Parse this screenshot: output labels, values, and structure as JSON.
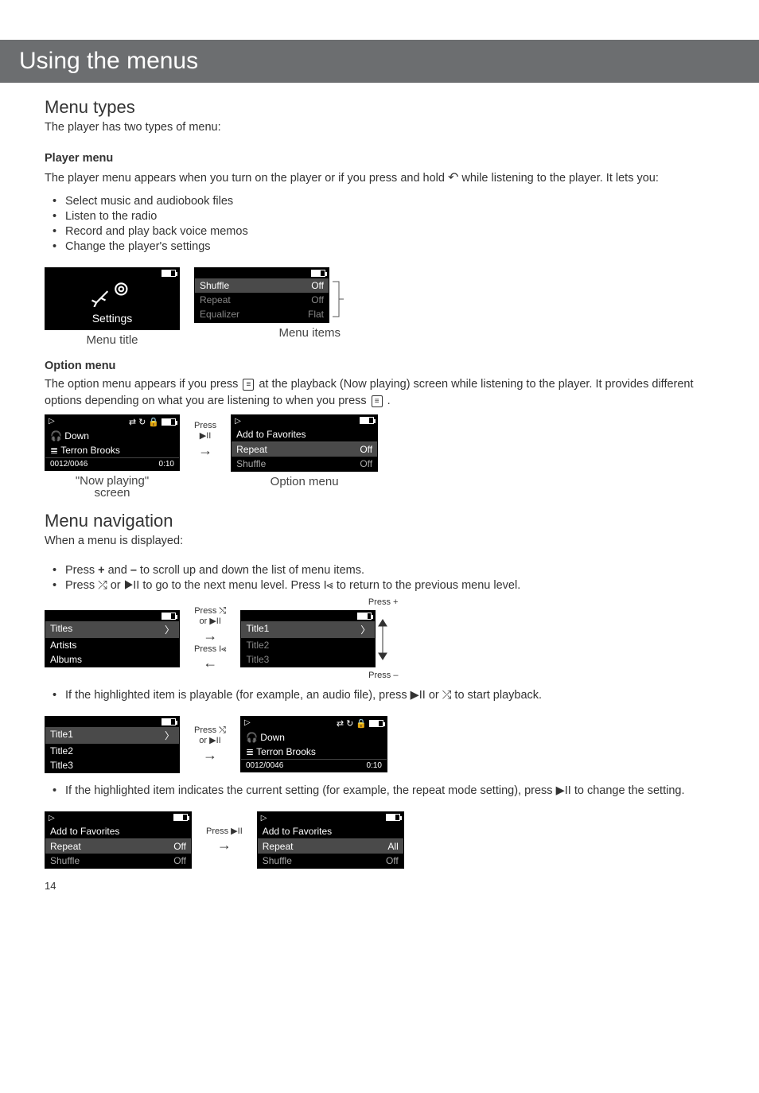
{
  "header": {
    "title": "Using the menus"
  },
  "section1": {
    "heading": "Menu types",
    "intro": "The player has two types of menu:"
  },
  "playerMenu": {
    "title": "Player menu",
    "desc_a": "The player menu appears when you turn on the player or if you press and hold ",
    "desc_b": " while listening to the player. It lets you:",
    "bullets": [
      "Select music and audiobook files",
      "Listen to the radio",
      "Record and play back voice memos",
      "Change the player's settings"
    ],
    "lcd1_caption": "Menu title",
    "lcd1_label": "Settings",
    "lcd2_caption": "Menu items",
    "lcd2_rows": [
      {
        "k": "Shuffle",
        "v": "Off"
      },
      {
        "k": "Repeat",
        "v": "Off"
      },
      {
        "k": "Equalizer",
        "v": "Flat"
      }
    ]
  },
  "optionMenu": {
    "title": "Option menu",
    "desc_a": "The option menu appears if you press ",
    "desc_b": " at the playback (Now playing) screen while listening to the player. It provides different options depending on what you are listening to when you press ",
    "desc_c": " .",
    "press_label1": "Press",
    "press_label2": "▶II",
    "now_playing": {
      "line1": "Down",
      "line2": "Terron Brooks",
      "counter": "0012/0046",
      "time": "0:10",
      "caption1": "\"Now playing\"",
      "caption2": "screen"
    },
    "opt_lcd": {
      "head": "Add to Favorites",
      "rows": [
        {
          "k": "Repeat",
          "v": "Off"
        },
        {
          "k": "Shuffle",
          "v": "Off"
        }
      ],
      "caption": "Option menu"
    }
  },
  "nav": {
    "heading": "Menu navigation",
    "intro": "When a menu is displayed:",
    "b1_a": "Press ",
    "b1_plus": "+",
    "b1_mid": " and ",
    "b1_minus": "–",
    "b1_b": " to scroll up and down the list of menu items.",
    "b2_a": "Press ",
    "b2_mid": " or ",
    "b2_b": " to go to the next menu level. Press ",
    "b2_c": " to return to the previous menu level.",
    "fwd_lbl1": "Press ⤭",
    "fwd_lbl2": "or ▶II",
    "back_lbl": "Press I⪡",
    "press_plus": "Press +",
    "press_minus": "Press –",
    "lcdA_rows": [
      "Titles",
      "Artists",
      "Albums"
    ],
    "lcdB_rows": [
      "Title1",
      "Title2",
      "Title3"
    ],
    "b3_a": "If the highlighted item is playable (for example, an audio file), press ",
    "b3_mid": " or ",
    "b3_b": " to start playback.",
    "lcdC_rows": [
      "Title1",
      "Title2",
      "Title3"
    ],
    "np2": {
      "line1": "Down",
      "line2": "Terron Brooks",
      "counter": "0012/0046",
      "time": "0:10"
    },
    "b4_a": "If the highlighted item indicates the current setting (for example, the repeat mode setting), press ",
    "b4_b": " to change the setting.",
    "press_play": "Press ▶II",
    "lcdD": {
      "head": "Add to Favorites",
      "rows": [
        {
          "k": "Repeat",
          "v": "Off"
        },
        {
          "k": "Shuffle",
          "v": "Off"
        }
      ]
    },
    "lcdE": {
      "head": "Add to Favorites",
      "rows": [
        {
          "k": "Repeat",
          "v": "All"
        },
        {
          "k": "Shuffle",
          "v": "Off"
        }
      ]
    }
  },
  "pageNumber": "14"
}
